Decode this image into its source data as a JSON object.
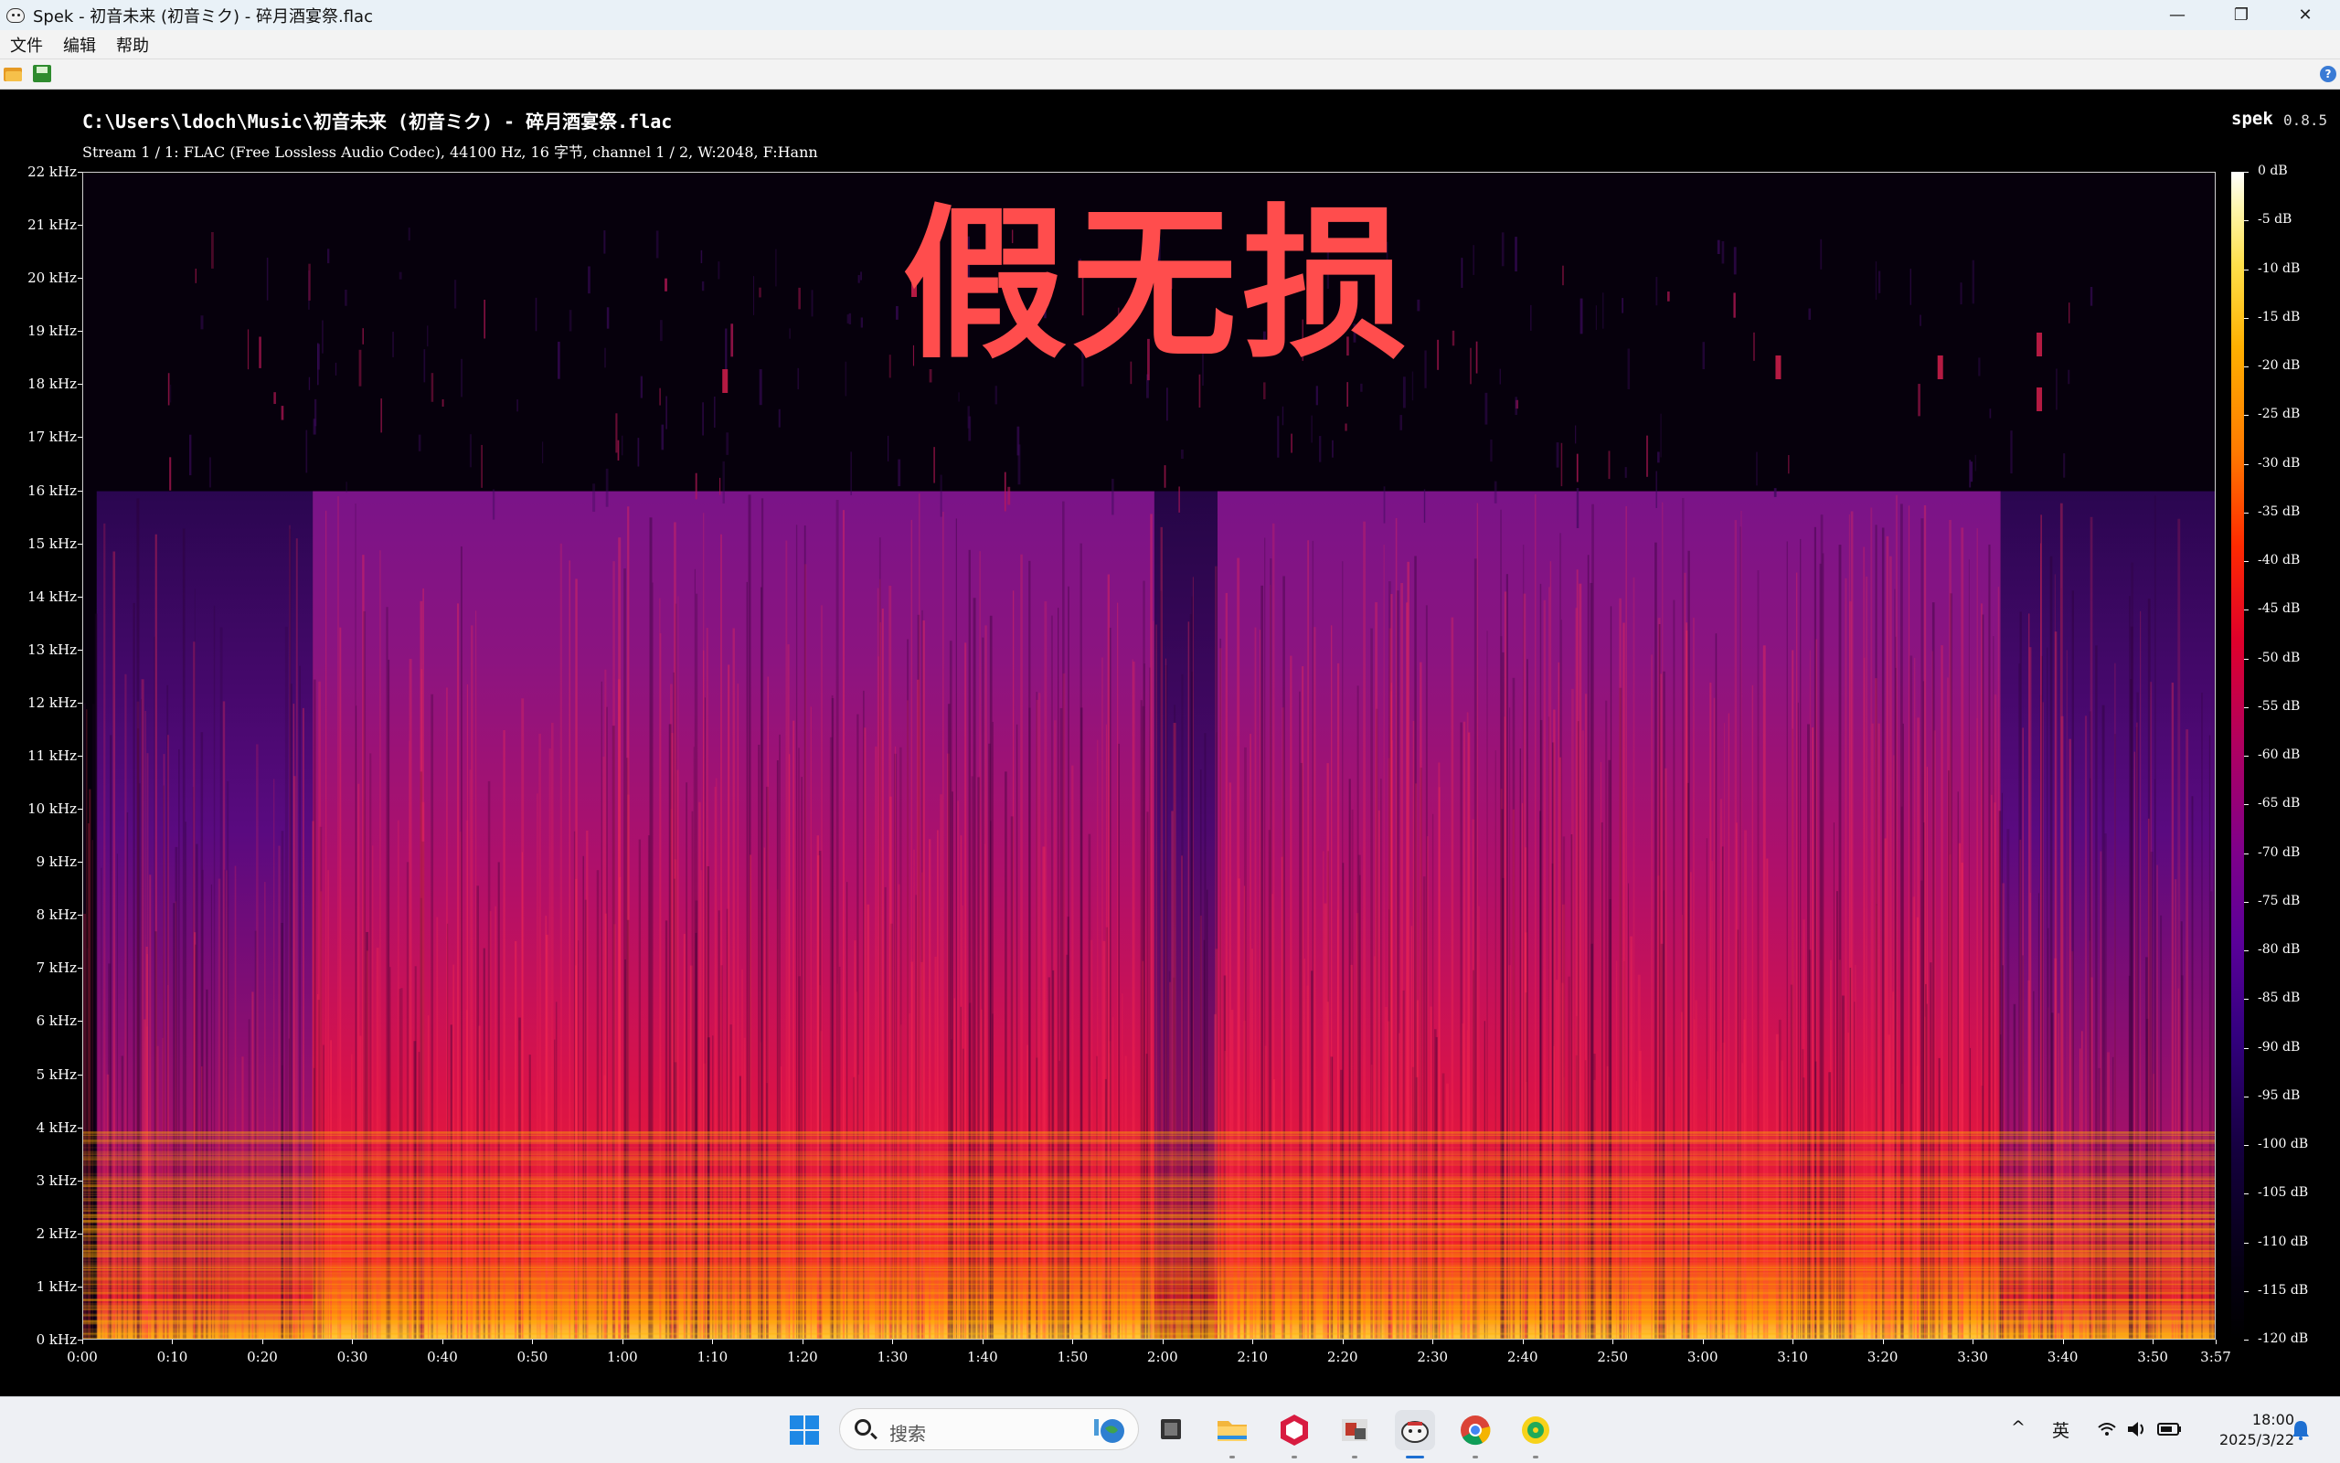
{
  "window": {
    "title": "Spek - 初音未来 (初音ミク) - 碎月酒宴祭.flac",
    "minimize_glyph": "—",
    "maximize_glyph": "❐",
    "close_glyph": "✕"
  },
  "menu": [
    "文件",
    "编辑",
    "帮助"
  ],
  "spek": {
    "file_path": "C:\\Users\\ldoch\\Music\\初音未来 (初音ミク) - 碎月酒宴祭.flac",
    "stream_info": "Stream 1 / 1: FLAC (Free Lossless Audio Codec), 44100 Hz, 16 字节, channel 1 / 2, W:2048, F:Hann",
    "app_name": "spek",
    "version": "0.8.5",
    "overlay_text": "假无损"
  },
  "chart_data": {
    "type": "heatmap",
    "y_axis": {
      "unit": "kHz",
      "ticks": [
        "0 kHz",
        "1 kHz",
        "2 kHz",
        "3 kHz",
        "4 kHz",
        "5 kHz",
        "6 kHz",
        "7 kHz",
        "8 kHz",
        "9 kHz",
        "10 kHz",
        "11 kHz",
        "12 kHz",
        "13 kHz",
        "14 kHz",
        "15 kHz",
        "16 kHz",
        "17 kHz",
        "18 kHz",
        "19 kHz",
        "20 kHz",
        "21 kHz",
        "22 kHz"
      ],
      "range": [
        0,
        22
      ]
    },
    "x_axis": {
      "ticks": [
        "0:00",
        "0:10",
        "0:20",
        "0:30",
        "0:40",
        "0:50",
        "1:00",
        "1:10",
        "1:20",
        "1:30",
        "1:40",
        "1:50",
        "2:00",
        "2:10",
        "2:20",
        "2:30",
        "2:40",
        "2:50",
        "3:00",
        "3:10",
        "3:20",
        "3:30",
        "3:40",
        "3:50",
        "3:57"
      ],
      "range_seconds": [
        0,
        237
      ]
    },
    "color_scale": {
      "unit": "dB",
      "ticks": [
        "0 dB",
        "-5 dB",
        "-10 dB",
        "-15 dB",
        "-20 dB",
        "-25 dB",
        "-30 dB",
        "-35 dB",
        "-40 dB",
        "-45 dB",
        "-50 dB",
        "-55 dB",
        "-60 dB",
        "-65 dB",
        "-70 dB",
        "-75 dB",
        "-80 dB",
        "-85 dB",
        "-90 dB",
        "-95 dB",
        "-100 dB",
        "-105 dB",
        "-110 dB",
        "-115 dB",
        "-120 dB"
      ],
      "range": [
        -120,
        0
      ]
    },
    "cutoff_khz": 16
  },
  "taskbar": {
    "search_placeholder": "搜索",
    "ime": "英",
    "time": "18:00",
    "date": "2025/3/22",
    "tray_chevron": "^"
  }
}
